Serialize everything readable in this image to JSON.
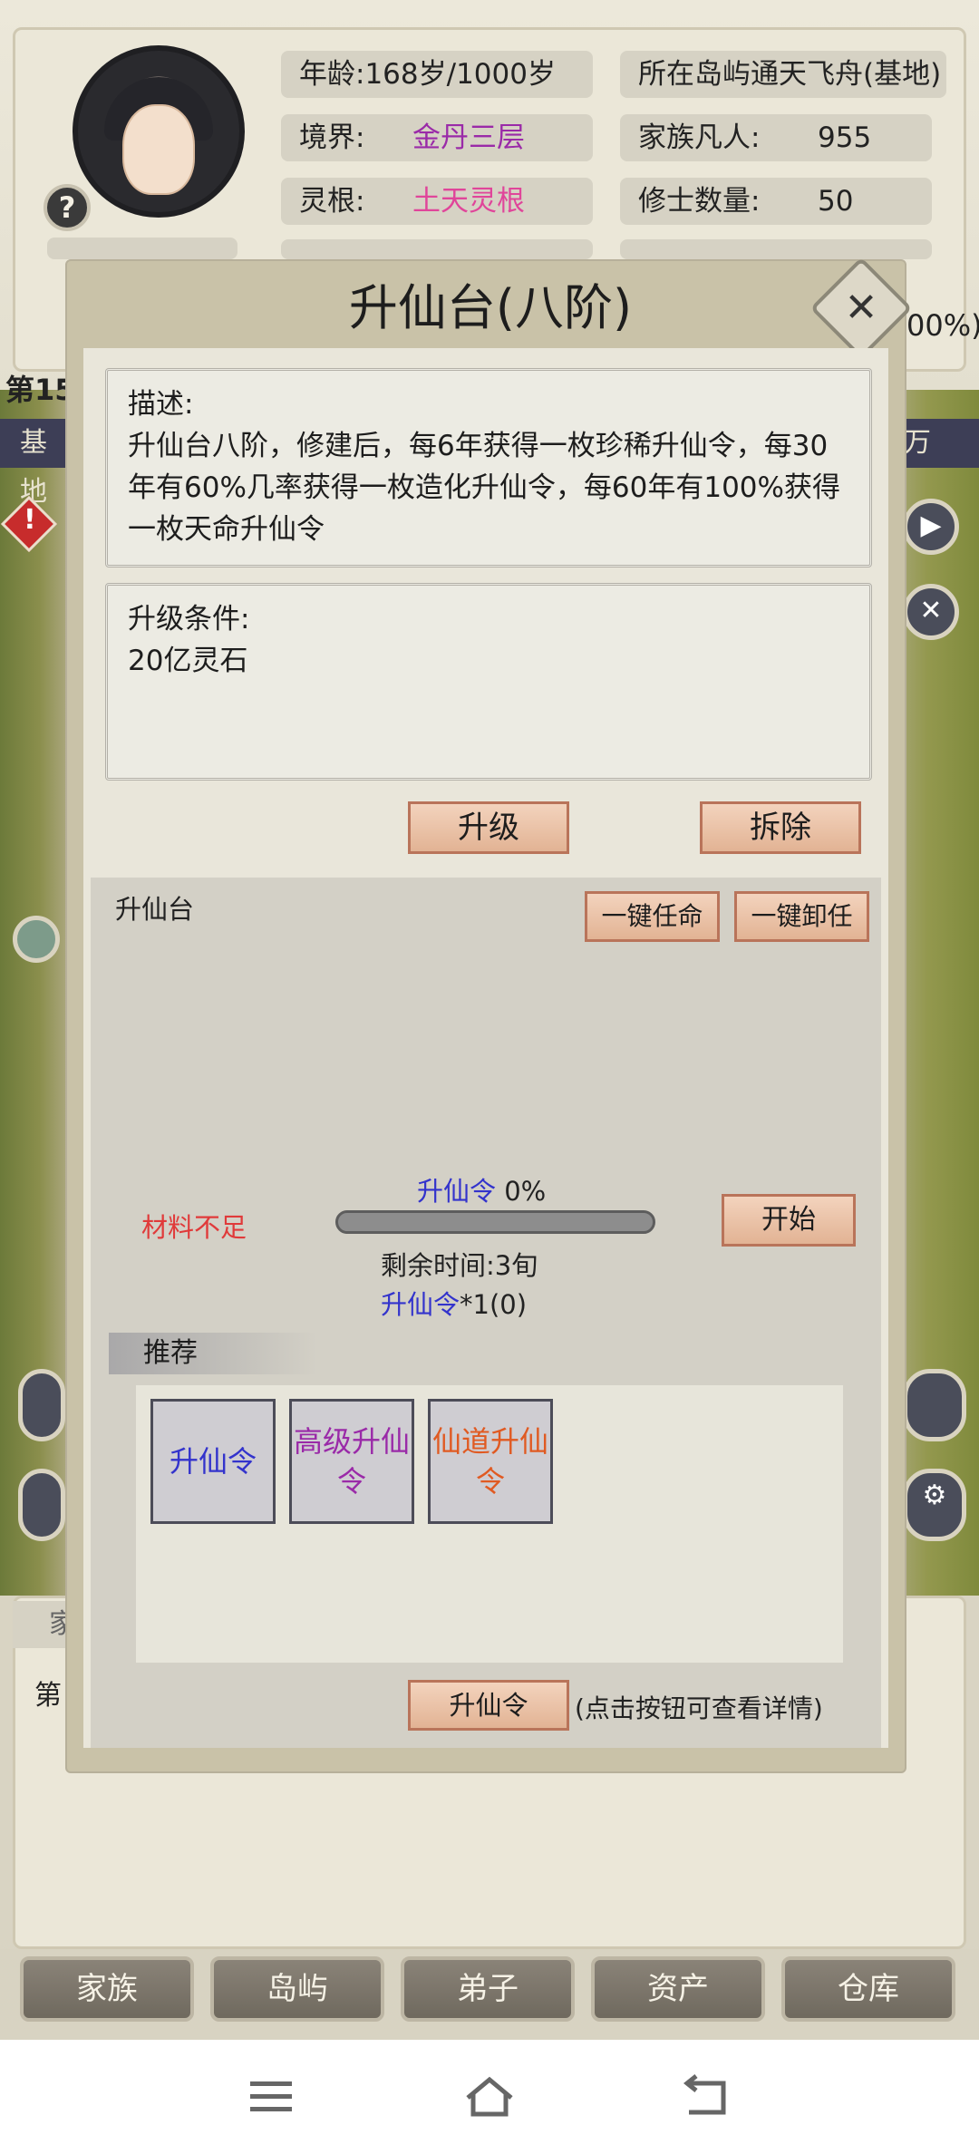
{
  "status": {
    "age_label": "年龄:",
    "age_value": "168岁/1000岁",
    "realm_label": "境界:",
    "realm_value": "金丹三层",
    "root_label": "灵根:",
    "root_value": "土天灵根",
    "island_label": "所在岛屿",
    "island_value": "通天飞舟(基地)",
    "mortals_label": "家族凡人:",
    "mortals_value": "955",
    "cultivators_label": "修士数量:",
    "cultivators_value": "50",
    "partial_right_pct": "00%)",
    "partial_row_label": "第15",
    "partial_left_bar": "基地",
    "partial_right_bar": "万",
    "bottom_partial_tab": "家",
    "bottom_partial_text": "第"
  },
  "modal": {
    "title": "升仙台(八阶)",
    "description_label": "描述:",
    "description_text": "升仙台八阶，修建后，每6年获得一枚珍稀升仙令，每30年有60%几率获得一枚造化升仙令，每60年有100%获得一枚天命升仙令",
    "condition_label": "升级条件:",
    "condition_text": "20亿灵石",
    "upgrade_button": "升级",
    "demolish_button": "拆除",
    "panel_title": "升仙台",
    "appoint_all_button": "一键任命",
    "dismiss_all_button": "一键卸任",
    "insufficient_materials": "材料不足",
    "progress_item_name": "升仙令",
    "progress_percent_text": "0%",
    "progress_value": 0,
    "start_button": "开始",
    "remaining_time": "剩余时间:3旬",
    "output_item": "升仙令",
    "output_count": "*1(0)",
    "recommend_label": "推荐",
    "recommend_items": [
      {
        "label": "升仙令",
        "color": "#3333cc"
      },
      {
        "label": "高级升仙令",
        "color": "#9a2aa8"
      },
      {
        "label": "仙道升仙令",
        "color": "#e05a22"
      }
    ],
    "detail_button": "升仙令",
    "detail_hint": "(点击按钮可查看详情)"
  },
  "nav": {
    "items": [
      "家族",
      "岛屿",
      "弟子",
      "资产",
      "仓库"
    ]
  },
  "system_nav": {
    "icons": [
      "menu-icon",
      "home-icon",
      "back-icon"
    ]
  },
  "colors": {
    "accent_button": "#e2b394",
    "purple_text": "#9a2aa8",
    "pink_text": "#e0459a",
    "blue_text": "#3333cc",
    "red_text": "#e03a3a"
  }
}
